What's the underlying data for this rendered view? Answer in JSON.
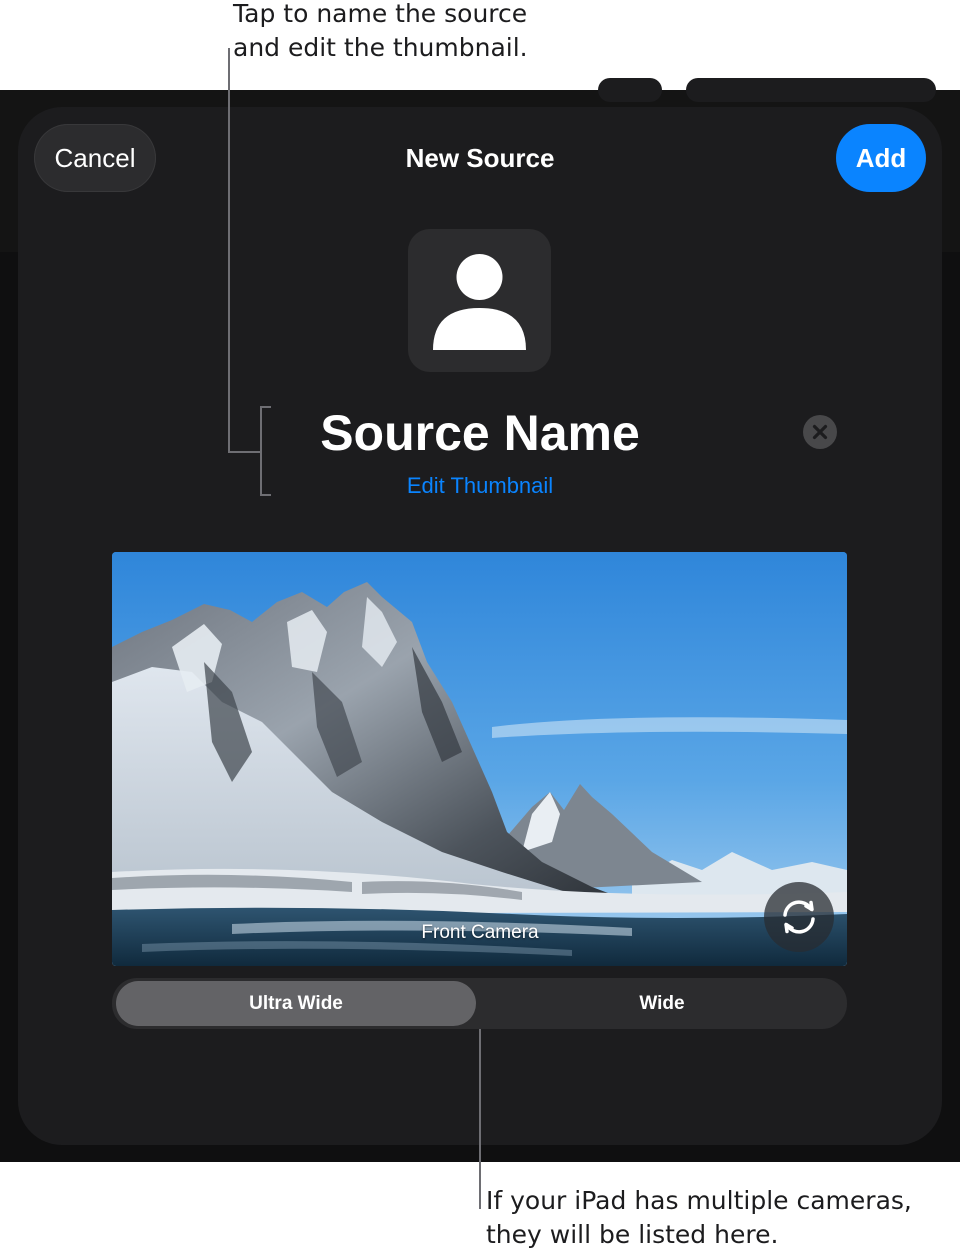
{
  "callouts": {
    "top_line1": "Tap to name the source",
    "top_line2": "and edit the thumbnail.",
    "bottom_line1": "If your iPad has multiple cameras,",
    "bottom_line2": "they will be listed here."
  },
  "sheet": {
    "cancel_label": "Cancel",
    "title": "New Source",
    "add_label": "Add",
    "thumbnail_icon": "person-icon",
    "source_name": "Source Name",
    "clear_icon": "clear-x-icon",
    "edit_thumbnail_label": "Edit Thumbnail"
  },
  "camera": {
    "label": "Front Camera",
    "flip_icon": "camera-flip-icon",
    "lenses": [
      "Ultra Wide",
      "Wide"
    ],
    "selected_lens": "Ultra Wide"
  },
  "colors": {
    "accent": "#0a84ff",
    "sheet_background": "#1c1c1e",
    "control_background": "#2c2c2e",
    "selected_segment": "#636366"
  }
}
